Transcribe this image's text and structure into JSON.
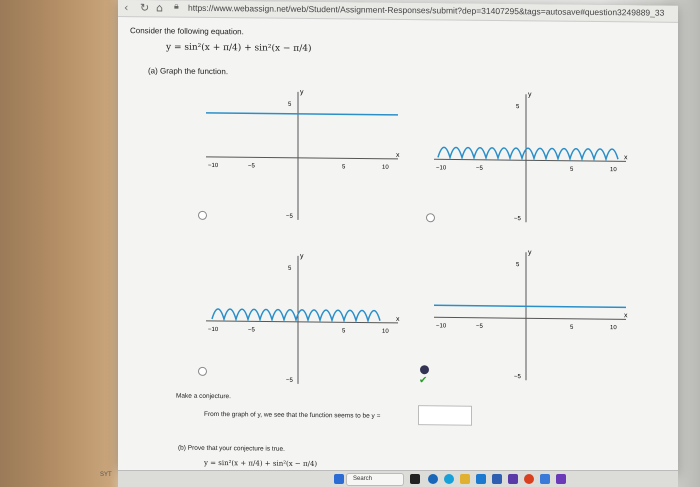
{
  "browser": {
    "url": "https://www.webassign.net/web/Student/Assignment-Responses/submit?dep=31407295&tags=autosave#question3249889_33"
  },
  "problem": {
    "intro": "Consider the following equation.",
    "equation": "y = sin²(x + π/4) + sin²(x − π/4)",
    "part_a": "(a) Graph the function.",
    "conjecture_heading": "Make a conjecture.",
    "conjecture_text": "From the graph of y, we see that the function seems to be y =",
    "answer_value": "",
    "part_b": "(b) Prove that your conjecture is true.",
    "part_b_equation": "y = sin²(x + π/4) + sin²(x − π/4)"
  },
  "graphs": {
    "axis_x": "x",
    "axis_y": "y",
    "ticks_x": [
      "−10",
      "−5",
      "5",
      "10"
    ],
    "tick_y_top": "5",
    "tick_y_bottom": "−5",
    "options": [
      {
        "id": "A",
        "curve": "horizontal-line-y-1",
        "selected": false
      },
      {
        "id": "B",
        "curve": "oscillating-wave",
        "selected": false
      },
      {
        "id": "C",
        "curve": "oscillating-wave",
        "selected": false
      },
      {
        "id": "D",
        "curve": "horizontal-line-y-1",
        "selected": true
      }
    ],
    "curve_color": "#2a8fc9"
  },
  "taskbar": {
    "search_label": "Search",
    "corner_text": "SYT"
  }
}
